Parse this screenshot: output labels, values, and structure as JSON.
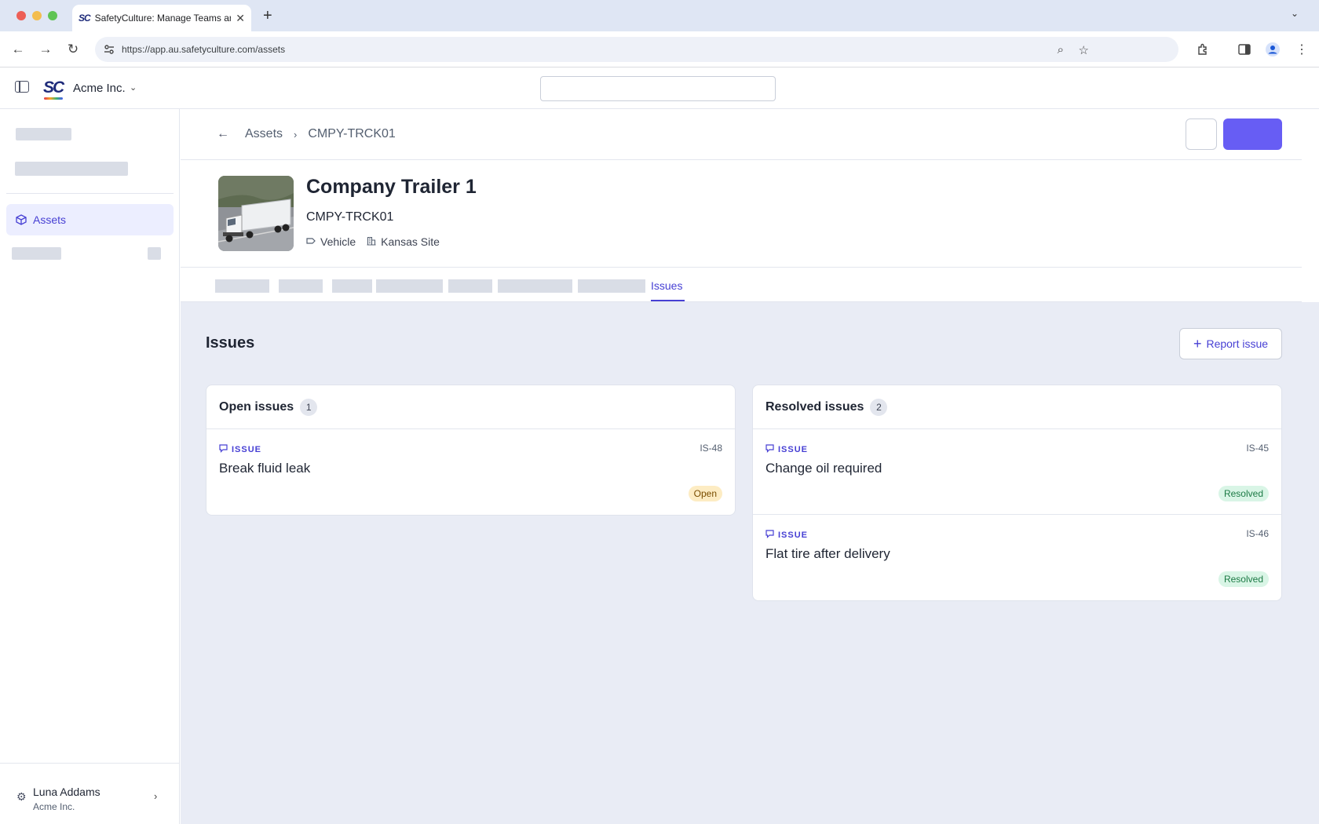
{
  "browser": {
    "tab_title": "SafetyCulture: Manage Teams and...",
    "tab_favicon": "SC",
    "url": "https://app.au.safetyculture.com/assets"
  },
  "header": {
    "logo": "SC",
    "org_name": "Acme Inc."
  },
  "sidebar": {
    "active_item": "Assets",
    "user_name": "Luna Addams",
    "user_org": "Acme Inc."
  },
  "breadcrumb": {
    "parent": "Assets",
    "current": "CMPY-TRCK01"
  },
  "asset": {
    "title": "Company Trailer 1",
    "code": "CMPY-TRCK01",
    "type": "Vehicle",
    "site": "Kansas Site"
  },
  "tabs": {
    "active": "Issues"
  },
  "issues": {
    "heading": "Issues",
    "report_button": "Report issue",
    "open": {
      "title": "Open issues",
      "count": "1",
      "items": [
        {
          "kind": "ISSUE",
          "id": "IS-48",
          "title": "Break fluid leak",
          "status": "Open"
        }
      ]
    },
    "resolved": {
      "title": "Resolved issues",
      "count": "2",
      "items": [
        {
          "kind": "ISSUE",
          "id": "IS-45",
          "title": "Change oil required",
          "status": "Resolved"
        },
        {
          "kind": "ISSUE",
          "id": "IS-46",
          "title": "Flat tire after delivery",
          "status": "Resolved"
        }
      ]
    }
  },
  "colors": {
    "accent": "#4740d4",
    "primary_button": "#675df4",
    "content_bg": "#e9ecf5"
  }
}
